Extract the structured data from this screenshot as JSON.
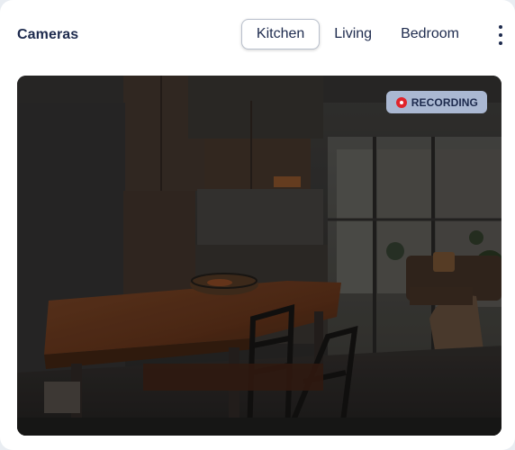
{
  "card": {
    "title": "Cameras"
  },
  "tabs": [
    {
      "label": "Kitchen",
      "active": true
    },
    {
      "label": "Living",
      "active": false
    },
    {
      "label": "Bedroom",
      "active": false
    }
  ],
  "menu": {
    "icon": "more-vertical-icon"
  },
  "feed": {
    "room": "Kitchen",
    "badge_label": "RECORDING",
    "badge_icon": "record-dot-icon"
  },
  "colors": {
    "text": "#1d2a4d",
    "badge_bg": "#aab8d2",
    "record": "#e0242b"
  }
}
